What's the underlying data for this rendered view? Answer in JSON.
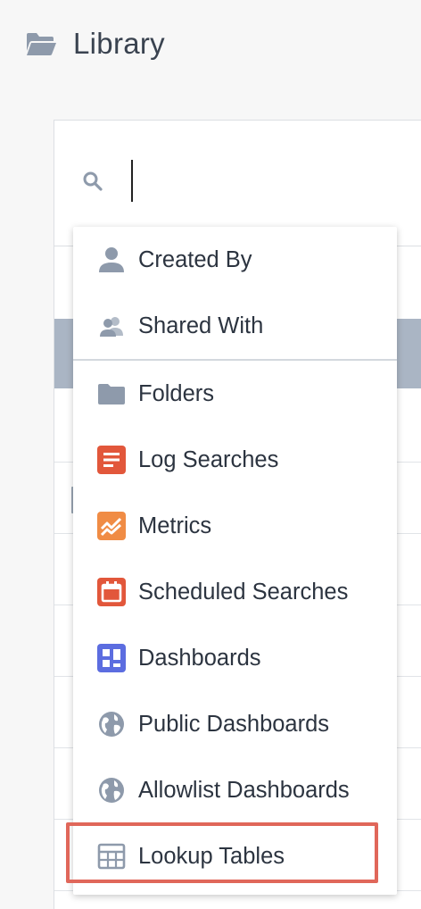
{
  "header": {
    "title": "Library",
    "icon": "folder-open-icon"
  },
  "search": {
    "value": "",
    "icon": "search-icon"
  },
  "menu": {
    "items": [
      {
        "id": "created-by",
        "label": "Created By",
        "icon": "user-icon",
        "color": "#8e9aab"
      },
      {
        "id": "shared-with",
        "label": "Shared With",
        "icon": "users-icon",
        "color": "#8e9aab"
      },
      {
        "id": "folders",
        "label": "Folders",
        "icon": "folder-icon",
        "color": "#8e9aab"
      },
      {
        "id": "log-searches",
        "label": "Log Searches",
        "icon": "log-search-icon",
        "color": "#e2573b"
      },
      {
        "id": "metrics",
        "label": "Metrics",
        "icon": "metrics-icon",
        "color": "#f08c45"
      },
      {
        "id": "scheduled-searches",
        "label": "Scheduled Searches",
        "icon": "calendar-icon",
        "color": "#e2573b"
      },
      {
        "id": "dashboards",
        "label": "Dashboards",
        "icon": "dashboard-icon",
        "color": "#5c6de0"
      },
      {
        "id": "public-dashboards",
        "label": "Public Dashboards",
        "icon": "globe-icon",
        "color": "#8e9aab"
      },
      {
        "id": "allowlist-dashboards",
        "label": "Allowlist Dashboards",
        "icon": "globe-icon",
        "color": "#8e9aab"
      },
      {
        "id": "lookup-tables",
        "label": "Lookup Tables",
        "icon": "table-icon",
        "color": "#8e9aab"
      }
    ],
    "highlighted": "Lookup Tables",
    "highlight_color": "#e0675a"
  }
}
